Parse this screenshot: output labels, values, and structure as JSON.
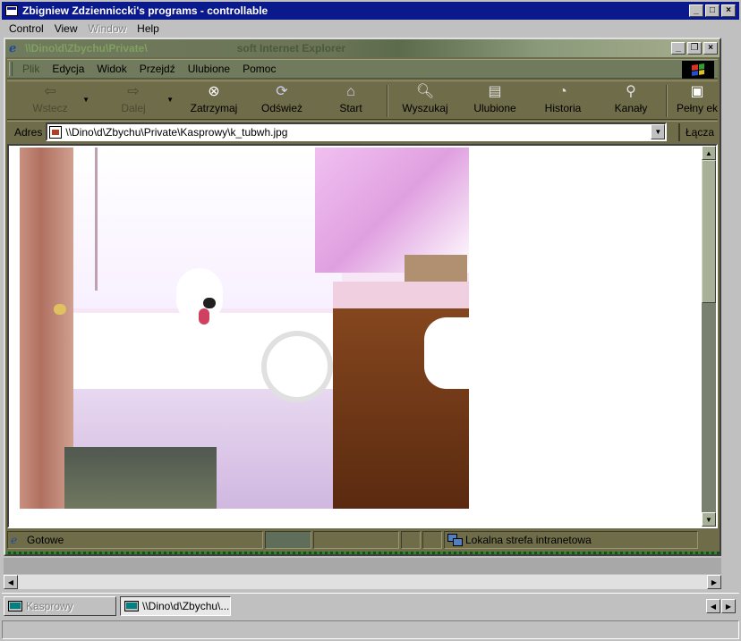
{
  "outer_window": {
    "title": "Zbigniew Zdzienniccki's programs - controllable",
    "menu": [
      {
        "label": "Control",
        "disabled": false
      },
      {
        "label": "View",
        "disabled": false
      },
      {
        "label": "Window",
        "disabled": true
      },
      {
        "label": "Help",
        "disabled": false
      }
    ]
  },
  "ie_window": {
    "title_path": "\\\\Dino\\d\\Zbychu\\Private\\",
    "title_app": "soft Internet Explorer",
    "menu": [
      "Plik",
      "Edycja",
      "Widok",
      "Przejdź",
      "Ulubione",
      "Pomoc"
    ],
    "toolbar": {
      "back": "Wstecz",
      "forward": "Dalej",
      "stop": "Zatrzymaj",
      "refresh": "Odśwież",
      "home": "Start",
      "search": "Wyszukaj",
      "favorites": "Ulubione",
      "history": "Historia",
      "channels": "Kanały",
      "fullscreen": "Pełny ek"
    },
    "address": {
      "label": "Adres",
      "value": "\\\\Dino\\d\\Zbychu\\Private\\Kasprowy\\k_tubwh.jpg",
      "links_label": "Łącza"
    },
    "status": {
      "text": "Gotowe",
      "zone": "Lokalna strefa intranetowa"
    }
  },
  "taskbar": {
    "items": [
      {
        "label": "Kasprowy",
        "active": false
      },
      {
        "label": "\\\\Dino\\d\\Zbychu\\...",
        "active": true
      }
    ]
  },
  "colors": {
    "outer_title_bg": "#0a1a8c",
    "ie_chrome": "#6f6c4a"
  }
}
